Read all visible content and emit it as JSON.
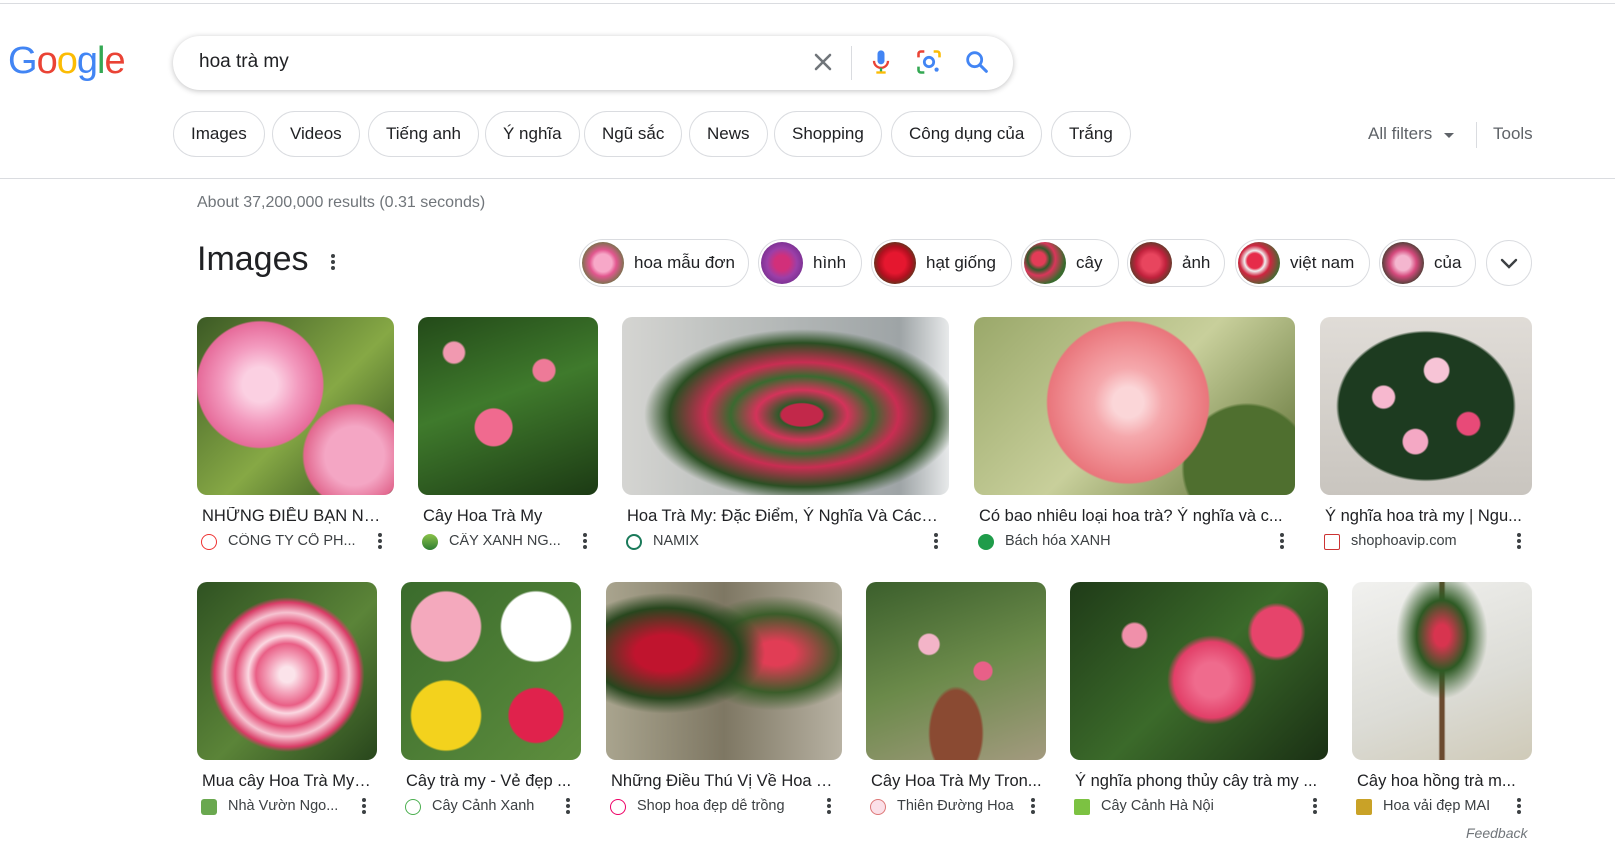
{
  "logo": {
    "letters": [
      "G",
      "o",
      "o",
      "g",
      "l",
      "e"
    ]
  },
  "search": {
    "query": "hoa trà my"
  },
  "filters": [
    "Images",
    "Videos",
    "Tiếng anh",
    "Ý nghĩa",
    "Ngũ sắc",
    "News",
    "Shopping",
    "Công dụng của",
    "Trắng"
  ],
  "toolbar": {
    "all_filters": "All filters",
    "tools": "Tools"
  },
  "stats": "About 37,200,000 results (0.31 seconds)",
  "images_section": {
    "title": "Images",
    "related": [
      "hoa mẫu đơn",
      "hình",
      "hạt giống",
      "cây",
      "ảnh",
      "việt nam",
      "của"
    ],
    "row1": [
      {
        "title": "NHỮNG ĐIỀU BẠN NÊ...",
        "source": "CÔNG TY CỔ PH..."
      },
      {
        "title": "Cây Hoa Trà My",
        "source": "CÂY XANH NG..."
      },
      {
        "title": "Hoa Trà My: Đặc Điểm, Ý Nghĩa Và Cách ...",
        "source": "NAMIX"
      },
      {
        "title": "Có bao nhiêu loại hoa trà? Ý nghĩa và c...",
        "source": "Bách hóa XANH"
      },
      {
        "title": "Ý nghĩa hoa trà my | Ngu...",
        "source": "shophoavip.com"
      }
    ],
    "row2": [
      {
        "title": "Mua cây Hoa Trà My ...",
        "source": "Nhà Vườn Ngo..."
      },
      {
        "title": "Cây trà my - Vẻ đẹp ...",
        "source": "Cây Cảnh Xanh"
      },
      {
        "title": "Những Điều Thú Vị Về Hoa T...",
        "source": "Shop hoa đẹp dễ trồng"
      },
      {
        "title": "Cây Hoa Trà My Tron...",
        "source": "Thiên Đường Hoa"
      },
      {
        "title": "Ý nghĩa phong thủy cây trà my ...",
        "source": "Cây Cảnh Hà Nội"
      },
      {
        "title": "Cây hoa hồng trà m...",
        "source": "Hoa vải đẹp MAI"
      }
    ]
  },
  "feedback": "Feedback",
  "colors": {
    "blue": "#4285f4",
    "red": "#ea4335",
    "yellow": "#fbbc05",
    "green": "#34a853"
  }
}
